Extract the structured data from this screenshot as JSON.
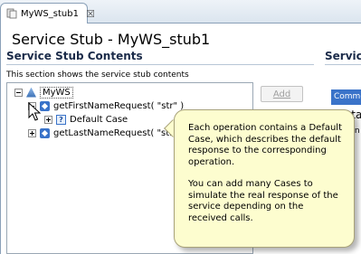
{
  "tab": {
    "label": "MyWS_stub1",
    "close_glyph": "☒"
  },
  "page": {
    "title": "Service Stub - MyWS_stub1"
  },
  "sections": {
    "left": {
      "title": "Service Stub Contents",
      "description": "This section shows the service stub contents"
    },
    "right": {
      "title": "Servic"
    }
  },
  "tree": {
    "root": {
      "label": "MyWS"
    },
    "operations": [
      {
        "label": "getFirstNameRequest( \"str\" )",
        "children": [
          {
            "label": "Default Case"
          }
        ]
      },
      {
        "label": "getLastNameRequest( \"str\" )"
      }
    ]
  },
  "buttons": {
    "add_label": "Add"
  },
  "right_panel": {
    "tab_label": "Common",
    "text1": "sta",
    "text2": "Fan"
  },
  "callout": {
    "paragraph1": "Each operation contains a Default Case, which describes the default response to the corresponding operation.",
    "paragraph2": "You can add many Cases to simulate the real response of the service depending on the received calls."
  },
  "colors": {
    "accent": "#3a73c9",
    "callout_bg": "#fdfdcf",
    "tab_border": "#8aa0b8"
  },
  "icons": {
    "tab": "stub-icon",
    "ws": "web-service-icon",
    "operation": "operation-icon",
    "case": "case-icon"
  }
}
